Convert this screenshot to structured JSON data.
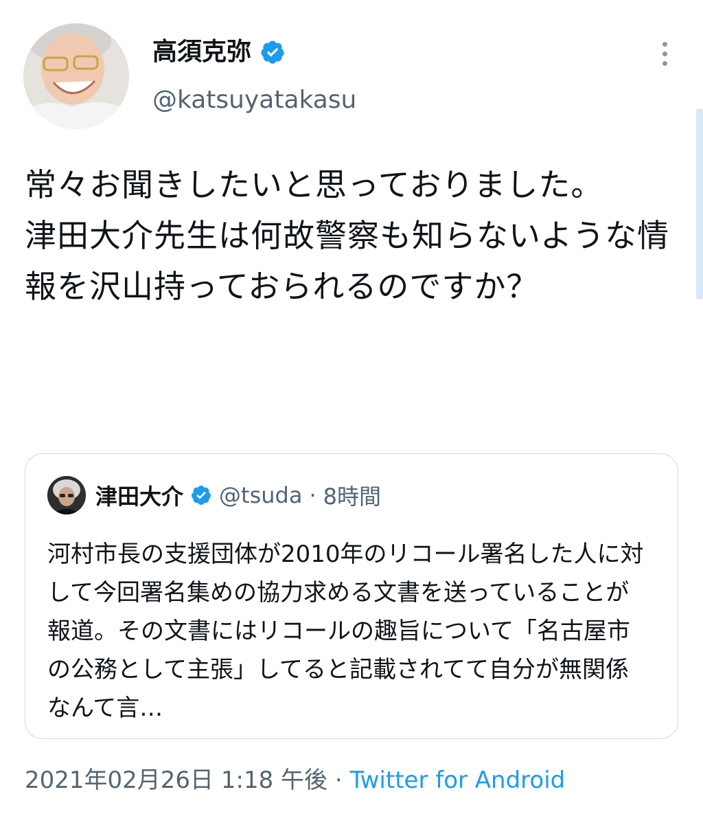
{
  "author": {
    "name": "高須克弥",
    "handle": "@katsuyatakasu",
    "verified": true
  },
  "tweet": {
    "text": "常々お聞きしたいと思っておりました。\n津田大介先生は何故警察も知らないような情報を沢山持っておられるのですか？"
  },
  "quoted_tweet": {
    "author_name": "津田大介",
    "verified": true,
    "handle": "@tsuda",
    "separator": "·",
    "time": "8時間",
    "text": "河村市長の支援団体が2010年のリコール署名した人に対して今回署名集めの協力求める文書を送っていることが報道。その文書にはリコールの趣旨について「名古屋市の公務として主張」してると記載されてて自分が無関係なんて言…"
  },
  "meta": {
    "timestamp": "2021年02月26日 1:18 午後",
    "separator": "·",
    "source": "Twitter for Android"
  },
  "colors": {
    "accent": "#1d9bf0",
    "secondary_text": "#536471",
    "border": "#cfd9de"
  },
  "icons": {
    "verified": "verified-badge-icon",
    "more": "more-vertical-icon"
  }
}
